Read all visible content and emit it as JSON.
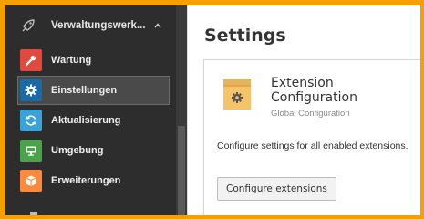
{
  "sidebar": {
    "group": {
      "label": "Verwaltungswerk...",
      "icon": "rocket-icon",
      "state_icon": "chevron-up-icon"
    },
    "items": [
      {
        "label": "Wartung",
        "icon": "wrench-icon",
        "color": "#e0493d",
        "active": false
      },
      {
        "label": "Einstellungen",
        "icon": "gear-icon",
        "color": "#1a6aa5",
        "active": true
      },
      {
        "label": "Aktualisierung",
        "icon": "refresh-icon",
        "color": "#3aa2d6",
        "active": false
      },
      {
        "label": "Umgebung",
        "icon": "monitor-icon",
        "color": "#4aa24a",
        "active": false
      },
      {
        "label": "Erweiterungen",
        "icon": "box-icon",
        "color": "#ff8a3d",
        "active": false
      }
    ]
  },
  "main": {
    "title": "Settings",
    "card": {
      "title": "Extension Configuration",
      "subtitle": "Global Configuration",
      "description": "Configure settings for all enabled extensions.",
      "button_label": "Configure extensions",
      "icon": "folder-gear-icon"
    }
  },
  "colors": {
    "frame": "#f5a000",
    "sidebar_bg": "#2d2d2d",
    "folder": "#f4c36a"
  }
}
